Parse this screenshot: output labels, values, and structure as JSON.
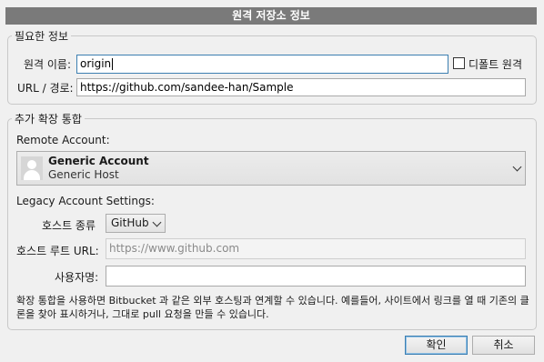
{
  "dialog": {
    "title": "원격 저장소 정보"
  },
  "required": {
    "legend": "필요한 정보",
    "remote_name_label": "원격 이름:",
    "remote_name_value": "origin",
    "default_remote_label": "디폴트 원격",
    "default_remote_checked": false,
    "url_label": "URL / 경로:",
    "url_value": "https://github.com/sandee-han/Sample"
  },
  "integration": {
    "legend": "추가 확장 통합",
    "remote_account_label": "Remote Account:",
    "account": {
      "name": "Generic Account",
      "host": "Generic Host"
    },
    "legacy_label": "Legacy Account Settings:",
    "host_type_label": "호스트 종류",
    "host_type_value": "GitHub",
    "host_root_label": "호스트 루트 URL:",
    "host_root_placeholder": "https://www.github.com",
    "username_label": "사용자명:",
    "username_value": "",
    "note": "확장 통합을 사용하면 Bitbucket 과 같은 외부 호스팅과 연계할 수 있습니다. 예를들어, 사이트에서 링크를 열 때 기존의 클론을 찾아 표시하거나, 그대로 pull 요청을 만들 수 있습니다."
  },
  "buttons": {
    "ok": "확인",
    "cancel": "취소"
  }
}
